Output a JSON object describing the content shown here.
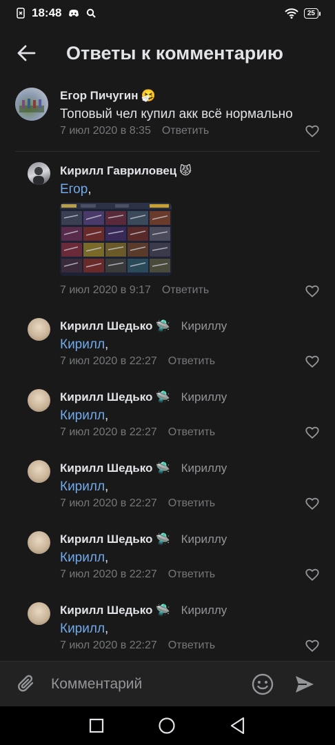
{
  "status_bar": {
    "time": "18:48",
    "battery": "25"
  },
  "header": {
    "title": "Ответы к комментарию"
  },
  "root_comment": {
    "author": "Егор Пичугин",
    "emoji": "🤧",
    "text": "Топовый чел купил акк всё нормально",
    "date": "7 июл 2020 в 8:35",
    "reply_label": "Ответить"
  },
  "replies": [
    {
      "author": "Кирилл Гавриловец",
      "emoji": "😾",
      "reply_to": "",
      "mention": "Егор",
      "date": "7 июл 2020 в 9:17",
      "reply_label": "Ответить",
      "has_image": true
    },
    {
      "author": "Кирилл Шедько",
      "emoji": "🛸",
      "reply_to": "Кириллу",
      "mention": "Кирилл",
      "date": "7 июл 2020 в 22:27",
      "reply_label": "Ответить"
    },
    {
      "author": "Кирилл Шедько",
      "emoji": "🛸",
      "reply_to": "Кириллу",
      "mention": "Кирилл",
      "date": "7 июл 2020 в 22:27",
      "reply_label": "Ответить"
    },
    {
      "author": "Кирилл Шедько",
      "emoji": "🛸",
      "reply_to": "Кириллу",
      "mention": "Кирилл",
      "date": "7 июл 2020 в 22:27",
      "reply_label": "Ответить"
    },
    {
      "author": "Кирилл Шедько",
      "emoji": "🛸",
      "reply_to": "Кириллу",
      "mention": "Кирилл",
      "date": "7 июл 2020 в 22:27",
      "reply_label": "Ответить"
    },
    {
      "author": "Кирилл Шедько",
      "emoji": "🛸",
      "reply_to": "Кириллу",
      "mention": "Кирилл",
      "date": "7 июл 2020 в 22:27",
      "reply_label": "Ответить"
    }
  ],
  "mention_suffix": ",",
  "composer": {
    "placeholder": "Комментарий"
  },
  "colors": {
    "background": "#19191a",
    "accent": "#71aaeb",
    "secondary_text": "#76787a"
  }
}
